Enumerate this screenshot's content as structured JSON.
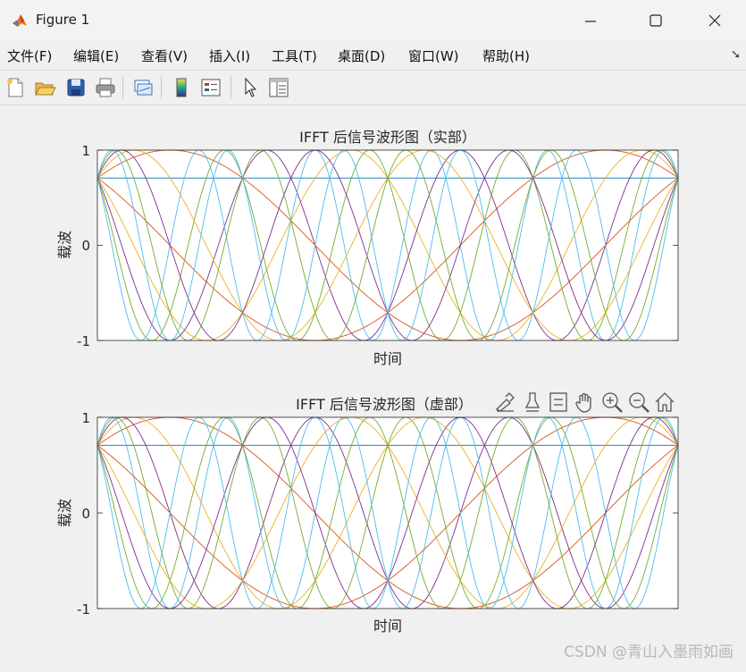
{
  "window": {
    "title": "Figure 1"
  },
  "menubar": {
    "items": [
      "文件(F)",
      "编辑(E)",
      "查看(V)",
      "插入(I)",
      "工具(T)",
      "桌面(D)",
      "窗口(W)",
      "帮助(H)"
    ],
    "overflow_icon": "chevron-arrow-icon"
  },
  "toolbar": {
    "buttons": [
      "new-figure-icon",
      "open-file-icon",
      "save-icon",
      "print-icon",
      "link-plot-icon",
      "insert-colorbar-icon",
      "insert-legend-icon",
      "edit-plot-arrow-icon",
      "property-inspector-icon"
    ]
  },
  "axes_toolbar": {
    "buttons": [
      "brush-icon",
      "data-tips-icon",
      "restore-view-icon",
      "pan-icon",
      "zoom-in-icon",
      "zoom-out-icon",
      "home-icon"
    ]
  },
  "colors": {
    "series": [
      "#0072BD",
      "#D95319",
      "#EDB120",
      "#7E2F8E",
      "#77AC30",
      "#4DBEEE"
    ]
  },
  "chart_data": [
    {
      "type": "line",
      "title": "IFFT 后信号波形图（实部）",
      "xlabel": "时间",
      "ylabel": "载波",
      "xlim": [
        0,
        1
      ],
      "ylim": [
        -1,
        1
      ],
      "yticks": [
        "1",
        "0",
        "-1"
      ],
      "xticks_visible": false,
      "grid": false,
      "legend": "none",
      "series": [
        {
          "frequency": 0,
          "function": "cos",
          "phase_deg": 45,
          "color": "#0072BD"
        },
        {
          "frequency": 1,
          "function": "cos",
          "phase_deg": 45,
          "color": "#D95319"
        },
        {
          "frequency": 2,
          "function": "cos",
          "phase_deg": 45,
          "color": "#EDB120"
        },
        {
          "frequency": 3,
          "function": "cos",
          "phase_deg": 45,
          "color": "#7E2F8E"
        },
        {
          "frequency": 4,
          "function": "cos",
          "phase_deg": 45,
          "color": "#77AC30"
        },
        {
          "frequency": 5,
          "function": "cos",
          "phase_deg": 45,
          "color": "#4DBEEE"
        },
        {
          "frequency": -1,
          "function": "cos",
          "phase_deg": 45,
          "color": "#D95319"
        },
        {
          "frequency": -2,
          "function": "cos",
          "phase_deg": 45,
          "color": "#EDB120"
        },
        {
          "frequency": -3,
          "function": "cos",
          "phase_deg": 45,
          "color": "#7E2F8E"
        },
        {
          "frequency": -4,
          "function": "cos",
          "phase_deg": 45,
          "color": "#77AC30"
        },
        {
          "frequency": -5,
          "function": "cos",
          "phase_deg": 45,
          "color": "#4DBEEE"
        }
      ]
    },
    {
      "type": "line",
      "title": "IFFT 后信号波形图（虚部）",
      "xlabel": "时间",
      "ylabel": "载波",
      "xlim": [
        0,
        1
      ],
      "ylim": [
        -1,
        1
      ],
      "yticks": [
        "1",
        "0",
        "-1"
      ],
      "xticks_visible": false,
      "grid": false,
      "legend": "none",
      "series": [
        {
          "frequency": 0,
          "function": "sin",
          "phase_deg": 45,
          "color": "#0072BD"
        },
        {
          "frequency": 1,
          "function": "sin",
          "phase_deg": 45,
          "color": "#D95319"
        },
        {
          "frequency": 2,
          "function": "sin",
          "phase_deg": 45,
          "color": "#EDB120"
        },
        {
          "frequency": 3,
          "function": "sin",
          "phase_deg": 45,
          "color": "#7E2F8E"
        },
        {
          "frequency": 4,
          "function": "sin",
          "phase_deg": 45,
          "color": "#77AC30"
        },
        {
          "frequency": 5,
          "function": "sin",
          "phase_deg": 45,
          "color": "#4DBEEE"
        },
        {
          "frequency": -1,
          "function": "sin",
          "phase_deg": 45,
          "color": "#D95319"
        },
        {
          "frequency": -2,
          "function": "sin",
          "phase_deg": 45,
          "color": "#EDB120"
        },
        {
          "frequency": -3,
          "function": "sin",
          "phase_deg": 45,
          "color": "#7E2F8E"
        },
        {
          "frequency": -4,
          "function": "sin",
          "phase_deg": 45,
          "color": "#77AC30"
        },
        {
          "frequency": -5,
          "function": "sin",
          "phase_deg": 45,
          "color": "#4DBEEE"
        }
      ]
    }
  ],
  "watermark": "CSDN @青山入墨雨如画"
}
